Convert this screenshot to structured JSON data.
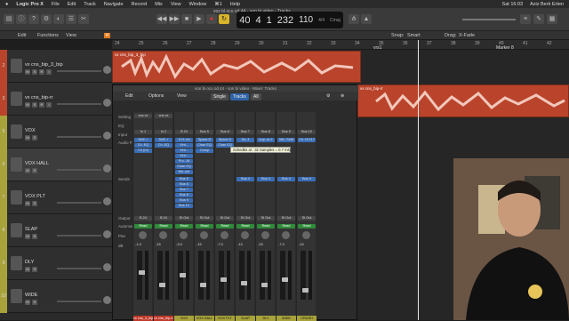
{
  "menubar": {
    "app": "Logic Pro X",
    "items": [
      "File",
      "Edit",
      "Track",
      "Navigate",
      "Record",
      "Mix",
      "View",
      "Window",
      "⌘1",
      "Help"
    ],
    "clock": "Sat 16:03",
    "user": "Aziz Berk Erten"
  },
  "window_title": "vox bl.ocu od.44 - son bi video - Tracks",
  "lcd": {
    "bar": "40",
    "beat": "4",
    "sub": "1",
    "tick": "232",
    "tempo": "110",
    "key": "Cmaj",
    "sig": "4/4"
  },
  "lcd_labels": {
    "bar": "BAR",
    "beat": "BEAT",
    "tempo": "KEEP TEMPO",
    "sig": "4/4"
  },
  "trackbar": {
    "edit": "Edit",
    "functions": "Functions",
    "view": "View",
    "snap_label": "Snap:",
    "snap": "Smart",
    "drag_label": "Drag:",
    "drag": "X-Fade"
  },
  "ruler": [
    "24",
    "25",
    "26",
    "27",
    "28",
    "29",
    "30",
    "31",
    "32",
    "33",
    "34",
    "35",
    "36",
    "37",
    "38",
    "39",
    "40",
    "41",
    "42"
  ],
  "ruler_markers": {
    "verse": "vrs1",
    "marker": "Marker 8"
  },
  "tracks": [
    {
      "num": "2",
      "name": "vx cns_bip_3_bip",
      "color": "#b9442b"
    },
    {
      "num": "3",
      "name": "vx cns_bip-rr",
      "color": "#b9442b"
    },
    {
      "num": "5",
      "name": "VOX",
      "color": "#a8a23a"
    },
    {
      "num": "6",
      "name": "VOX HALL",
      "color": "#a8a23a"
    },
    {
      "num": "7",
      "name": "VOX PLT",
      "color": "#a8a23a"
    },
    {
      "num": "8",
      "name": "SLAP",
      "color": "#a8a23a"
    },
    {
      "num": "9",
      "name": "DLY",
      "color": "#a8a23a"
    },
    {
      "num": "10",
      "name": "WIDE",
      "color": "#a8a23a"
    }
  ],
  "track_buttons": [
    "M",
    "S",
    "R",
    "I"
  ],
  "regions": [
    {
      "name": "vx cns_bip_3_bip"
    },
    {
      "name": "vx cns_bip-rr"
    }
  ],
  "mixer": {
    "title": "son bi ocu od.44 - son bi video - Mixer: Tracks",
    "edit": "Edit",
    "options": "Options",
    "view": "View",
    "single": "Single",
    "tracks": "Tracks",
    "all": "All",
    "row_labels": [
      "Setting",
      "EQ",
      "Input",
      "Audio FX",
      "Sends",
      "Output",
      "Automation",
      "Pan",
      "dB"
    ],
    "strips": [
      {
        "name": "vx cns_3_bip",
        "setting": "cns vx",
        "input": "In 1",
        "fx": [
          "DeE..r",
          "Ch..EQ",
          "C4 (m)"
        ],
        "sends": [],
        "output": "B 24",
        "auto": "Read",
        "db": "-1.0",
        "color": "#c0392b"
      },
      {
        "name": "vx cns_bip-rr",
        "setting": "cns vx",
        "input": "In 2",
        "fx": [
          "DeE..r",
          "Ch..EQ"
        ],
        "sends": [],
        "output": "B 24",
        "auto": "Read",
        "db": "-15",
        "color": "#c0392b"
      },
      {
        "name": "VOX",
        "setting": "",
        "input": "B 24",
        "fx": [
          "X-H..rrs",
          "Vint...",
          "Vint...",
          "Vint...",
          "Pro..-M",
          "Chan EQ",
          "Mo..ool"
        ],
        "sends": [
          "Bus 5",
          "Bus 6",
          "Bus 7",
          "Bus 8",
          "Bus 9",
          "Bus 10"
        ],
        "output": "St Out",
        "auto": "Read",
        "db": "-3.0",
        "color": "#a8a23a"
      },
      {
        "name": "VOX HALL",
        "setting": "",
        "input": "Bus 5",
        "fx": [
          "Space D",
          "Chan EQ",
          "Comp"
        ],
        "sends": [],
        "output": "St Out",
        "auto": "Read",
        "db": "-15",
        "color": "#a8a23a"
      },
      {
        "name": "VOX PLT",
        "setting": "",
        "input": "Bus 6",
        "fx": [
          "Space D",
          "Chan EQ"
        ],
        "sends": [],
        "output": "St Out",
        "auto": "Read",
        "db": "-7.0",
        "color": "#a8a23a"
      },
      {
        "name": "SLAP",
        "setting": "",
        "input": "Bus 7",
        "fx": [
          "Sa..4"
        ],
        "sends": [
          "Bus 4"
        ],
        "output": "St Out",
        "auto": "Read",
        "db": "-13",
        "color": "#a8a23a"
      },
      {
        "name": "DLY",
        "setting": "",
        "input": "Bus 8",
        "fx": [
          "bup..ra 2"
        ],
        "sends": [
          "Bus 4"
        ],
        "output": "St Out",
        "auto": "Read",
        "db": "-15",
        "color": "#a8a23a"
      },
      {
        "name": "WIDE",
        "setting": "",
        "input": "Bus 9",
        "fx": [
          "Mic..Shift"
        ],
        "sends": [
          "Bus 4"
        ],
        "output": "St Out",
        "auto": "Read",
        "db": "-7.0",
        "color": "#a8a23a"
      },
      {
        "name": "CRUSH",
        "setting": "",
        "input": "Bus 10",
        "fx": [
          "Ch..Hi 117"
        ],
        "sends": [
          "Bus 4"
        ],
        "output": "St Out",
        "auto": "Read",
        "db": "-24",
        "color": "#a8a23a"
      }
    ],
    "tooltip": "Schedbs al : 32 Samples = 0.7 ms)"
  },
  "colors": {
    "audio_region": "#b9442b",
    "aux_track": "#a8a23a",
    "selected": "#3b7ac0",
    "read": "#2f8a3a"
  }
}
